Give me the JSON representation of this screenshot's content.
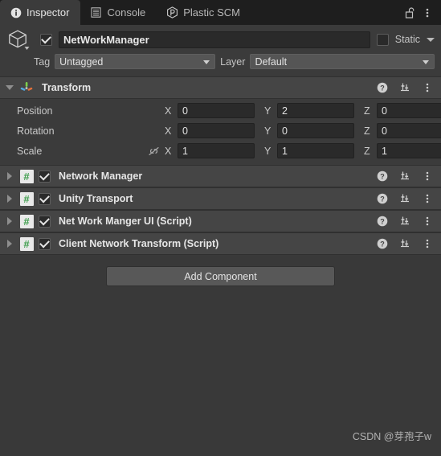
{
  "window": {
    "tabs": [
      {
        "label": "Inspector",
        "icon": "info-icon",
        "active": true
      },
      {
        "label": "Console",
        "icon": "console-lines-icon",
        "active": false
      },
      {
        "label": "Plastic SCM",
        "icon": "plastic-scm-icon",
        "active": false
      }
    ],
    "lock_icon": "unlocked-padlock-icon",
    "menu_icon": "kebab-menu-icon"
  },
  "gameobject": {
    "object_icon": "cube-icon",
    "enabled": true,
    "name_value": "NetWorkManager",
    "name_placeholder": "Name",
    "static_label": "Static",
    "static_checked": false,
    "tag_label": "Tag",
    "tag_value": "Untagged",
    "layer_label": "Layer",
    "layer_value": "Default"
  },
  "transform": {
    "title": "Transform",
    "icon": "transform-axis-icon",
    "expanded": true,
    "help_icon": "help-circle-icon",
    "preset_icon": "preset-sliders-icon",
    "menu_icon": "kebab-menu-icon",
    "rows": [
      {
        "label": "Position",
        "link_icon": "",
        "x_label": "X",
        "x_value": "0",
        "y_label": "Y",
        "y_value": "2",
        "z_label": "Z",
        "z_value": "0"
      },
      {
        "label": "Rotation",
        "link_icon": "",
        "x_label": "X",
        "x_value": "0",
        "y_label": "Y",
        "y_value": "0",
        "z_label": "Z",
        "z_value": "0"
      },
      {
        "label": "Scale",
        "link_icon": "constrain-proportions-off-icon",
        "x_label": "X",
        "x_value": "1",
        "y_label": "Y",
        "y_value": "1",
        "z_label": "Z",
        "z_value": "1"
      }
    ]
  },
  "components": [
    {
      "title": "Network Manager",
      "icon": "csharp-script-icon",
      "enabled": true,
      "expanded": false
    },
    {
      "title": "Unity Transport",
      "icon": "csharp-script-icon",
      "enabled": true,
      "expanded": false
    },
    {
      "title": "Net Work Manger UI (Script)",
      "icon": "csharp-script-icon",
      "enabled": true,
      "expanded": false
    },
    {
      "title": "Client Network Transform (Script)",
      "icon": "csharp-script-icon",
      "enabled": true,
      "expanded": false
    }
  ],
  "add_component": {
    "label": "Add Component"
  },
  "watermark": {
    "text": "CSDN @芽孢子w"
  },
  "colors": {
    "panel_bg": "#393939",
    "header_bg": "#3b3b3b",
    "comp_header_bg": "#454545",
    "tabbar_bg": "#1e1e1e",
    "field_bg": "#2a2a2a",
    "script_green": "#3f9e4d",
    "text": "#e6e6e6"
  }
}
